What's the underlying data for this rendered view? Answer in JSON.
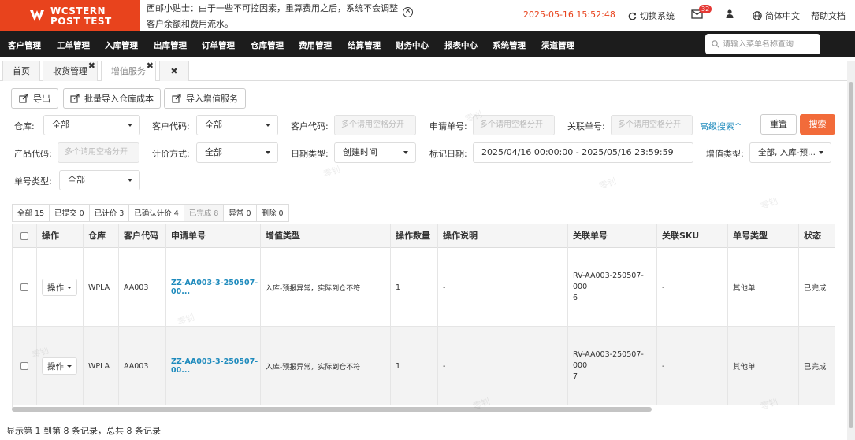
{
  "brand": {
    "line1": "WCSTERN",
    "line2": "POST TEST"
  },
  "notice": {
    "line1": "西邮小贴士：由于一些不可控因素，重算费用之后，系统不会调整",
    "line2": "客户余额和费用流水。"
  },
  "header": {
    "datetime": "2025-05-16 15:52:48",
    "switch_system": "切换系统",
    "mail_badge": "32",
    "language": "简体中文",
    "help": "帮助文档"
  },
  "nav": {
    "items": [
      "客户管理",
      "工单管理",
      "入库管理",
      "出库管理",
      "订单管理",
      "仓库管理",
      "费用管理",
      "结算管理",
      "财务中心",
      "报表中心",
      "系统管理",
      "渠道管理"
    ],
    "search_placeholder": "请输入菜单名称查询"
  },
  "tabs": [
    {
      "label": "首页"
    },
    {
      "label": "收货管理"
    },
    {
      "label": "增值服务"
    }
  ],
  "toolbar": {
    "export": "导出",
    "bulk_import_cost": "批量导入仓库成本",
    "import_vas": "导入增值服务"
  },
  "filters": {
    "warehouse_label": "仓库:",
    "warehouse_value": "全部",
    "customer_code_label": "客户代码:",
    "customer_code_value": "全部",
    "customer_code2_label": "客户代码:",
    "customer_code2_placeholder": "多个请用空格分开",
    "apply_no_label": "申请单号:",
    "apply_no_placeholder": "多个请用空格分开",
    "related_no_label": "关联单号:",
    "related_no_placeholder": "多个请用空格分开",
    "advanced_search": "高级搜索^",
    "reset": "重置",
    "search": "搜索",
    "product_code_label": "产品代码:",
    "product_code_placeholder": "多个请用空格分开",
    "pricing_label": "计价方式:",
    "pricing_value": "全部",
    "date_type_label": "日期类型:",
    "date_type_value": "创建时间",
    "mark_date_label": "标记日期:",
    "mark_date_value": "2025/04/16 00:00:00 - 2025/05/16 23:59:59",
    "vas_type_label": "增值类型:",
    "vas_type_value": "全部, 入库-预...",
    "doc_type_label": "单号类型:",
    "doc_type_value": "全部"
  },
  "status_tabs": [
    "全部 15",
    "已提交 0",
    "已计价 3",
    "已确认计价 4",
    "已完成 8",
    "异常 0",
    "删除 0"
  ],
  "table": {
    "headers": [
      "操作",
      "仓库",
      "客户代码",
      "申请单号",
      "增值类型",
      "操作数量",
      "操作说明",
      "关联单号",
      "关联SKU",
      "单号类型",
      "状态"
    ],
    "op_label": "操作",
    "rows": [
      {
        "warehouse": "WPLA",
        "customer": "AA003",
        "apply_no": "ZZ-AA003-3-250507-00...",
        "vas_type": "入库-预报异常，实际到仓不符",
        "qty": "1",
        "desc": "-",
        "related_no_1": "RV-AA003-250507-000",
        "related_no_2": "6",
        "sku": "-",
        "doc_type": "其他单",
        "status": "已完成"
      },
      {
        "warehouse": "WPLA",
        "customer": "AA003",
        "apply_no": "ZZ-AA003-3-250507-00...",
        "vas_type": "入库-预报异常，实际到仓不符",
        "qty": "1",
        "desc": "-",
        "related_no_1": "RV-AA003-250507-000",
        "related_no_2": "7",
        "sku": "-",
        "doc_type": "其他单",
        "status": "已完成"
      }
    ]
  },
  "footer": "显示第 1 到第 8 条记录，总共 8 条记录",
  "watermark": "零钊",
  "colors": {
    "brand": "#e8431d",
    "nav_bg": "#1c1c1c",
    "search_btn": "#f26b3a",
    "link": "#1f8bbd"
  }
}
